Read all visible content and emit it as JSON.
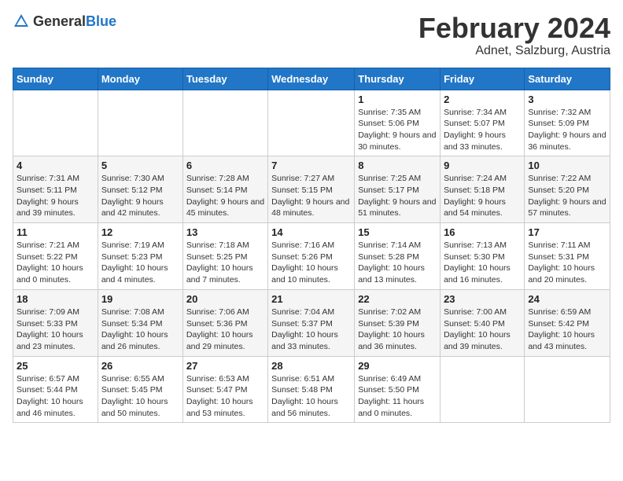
{
  "header": {
    "logo_general": "General",
    "logo_blue": "Blue",
    "month_title": "February 2024",
    "location": "Adnet, Salzburg, Austria"
  },
  "days_of_week": [
    "Sunday",
    "Monday",
    "Tuesday",
    "Wednesday",
    "Thursday",
    "Friday",
    "Saturday"
  ],
  "weeks": [
    [
      {
        "day": "",
        "info": ""
      },
      {
        "day": "",
        "info": ""
      },
      {
        "day": "",
        "info": ""
      },
      {
        "day": "",
        "info": ""
      },
      {
        "day": "1",
        "info": "Sunrise: 7:35 AM\nSunset: 5:06 PM\nDaylight: 9 hours and 30 minutes."
      },
      {
        "day": "2",
        "info": "Sunrise: 7:34 AM\nSunset: 5:07 PM\nDaylight: 9 hours and 33 minutes."
      },
      {
        "day": "3",
        "info": "Sunrise: 7:32 AM\nSunset: 5:09 PM\nDaylight: 9 hours and 36 minutes."
      }
    ],
    [
      {
        "day": "4",
        "info": "Sunrise: 7:31 AM\nSunset: 5:11 PM\nDaylight: 9 hours and 39 minutes."
      },
      {
        "day": "5",
        "info": "Sunrise: 7:30 AM\nSunset: 5:12 PM\nDaylight: 9 hours and 42 minutes."
      },
      {
        "day": "6",
        "info": "Sunrise: 7:28 AM\nSunset: 5:14 PM\nDaylight: 9 hours and 45 minutes."
      },
      {
        "day": "7",
        "info": "Sunrise: 7:27 AM\nSunset: 5:15 PM\nDaylight: 9 hours and 48 minutes."
      },
      {
        "day": "8",
        "info": "Sunrise: 7:25 AM\nSunset: 5:17 PM\nDaylight: 9 hours and 51 minutes."
      },
      {
        "day": "9",
        "info": "Sunrise: 7:24 AM\nSunset: 5:18 PM\nDaylight: 9 hours and 54 minutes."
      },
      {
        "day": "10",
        "info": "Sunrise: 7:22 AM\nSunset: 5:20 PM\nDaylight: 9 hours and 57 minutes."
      }
    ],
    [
      {
        "day": "11",
        "info": "Sunrise: 7:21 AM\nSunset: 5:22 PM\nDaylight: 10 hours and 0 minutes."
      },
      {
        "day": "12",
        "info": "Sunrise: 7:19 AM\nSunset: 5:23 PM\nDaylight: 10 hours and 4 minutes."
      },
      {
        "day": "13",
        "info": "Sunrise: 7:18 AM\nSunset: 5:25 PM\nDaylight: 10 hours and 7 minutes."
      },
      {
        "day": "14",
        "info": "Sunrise: 7:16 AM\nSunset: 5:26 PM\nDaylight: 10 hours and 10 minutes."
      },
      {
        "day": "15",
        "info": "Sunrise: 7:14 AM\nSunset: 5:28 PM\nDaylight: 10 hours and 13 minutes."
      },
      {
        "day": "16",
        "info": "Sunrise: 7:13 AM\nSunset: 5:30 PM\nDaylight: 10 hours and 16 minutes."
      },
      {
        "day": "17",
        "info": "Sunrise: 7:11 AM\nSunset: 5:31 PM\nDaylight: 10 hours and 20 minutes."
      }
    ],
    [
      {
        "day": "18",
        "info": "Sunrise: 7:09 AM\nSunset: 5:33 PM\nDaylight: 10 hours and 23 minutes."
      },
      {
        "day": "19",
        "info": "Sunrise: 7:08 AM\nSunset: 5:34 PM\nDaylight: 10 hours and 26 minutes."
      },
      {
        "day": "20",
        "info": "Sunrise: 7:06 AM\nSunset: 5:36 PM\nDaylight: 10 hours and 29 minutes."
      },
      {
        "day": "21",
        "info": "Sunrise: 7:04 AM\nSunset: 5:37 PM\nDaylight: 10 hours and 33 minutes."
      },
      {
        "day": "22",
        "info": "Sunrise: 7:02 AM\nSunset: 5:39 PM\nDaylight: 10 hours and 36 minutes."
      },
      {
        "day": "23",
        "info": "Sunrise: 7:00 AM\nSunset: 5:40 PM\nDaylight: 10 hours and 39 minutes."
      },
      {
        "day": "24",
        "info": "Sunrise: 6:59 AM\nSunset: 5:42 PM\nDaylight: 10 hours and 43 minutes."
      }
    ],
    [
      {
        "day": "25",
        "info": "Sunrise: 6:57 AM\nSunset: 5:44 PM\nDaylight: 10 hours and 46 minutes."
      },
      {
        "day": "26",
        "info": "Sunrise: 6:55 AM\nSunset: 5:45 PM\nDaylight: 10 hours and 50 minutes."
      },
      {
        "day": "27",
        "info": "Sunrise: 6:53 AM\nSunset: 5:47 PM\nDaylight: 10 hours and 53 minutes."
      },
      {
        "day": "28",
        "info": "Sunrise: 6:51 AM\nSunset: 5:48 PM\nDaylight: 10 hours and 56 minutes."
      },
      {
        "day": "29",
        "info": "Sunrise: 6:49 AM\nSunset: 5:50 PM\nDaylight: 11 hours and 0 minutes."
      },
      {
        "day": "",
        "info": ""
      },
      {
        "day": "",
        "info": ""
      }
    ]
  ]
}
